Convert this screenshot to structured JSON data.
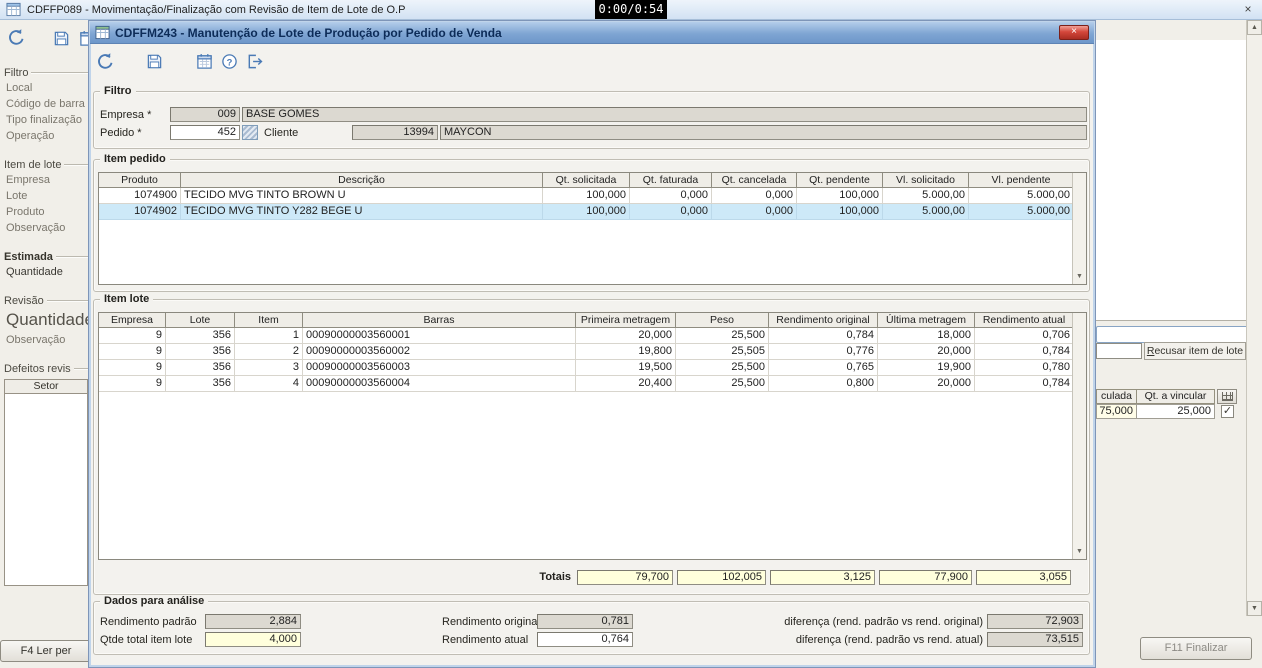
{
  "timer": {
    "text": "0:00/0:54"
  },
  "bg": {
    "title": "CDFFP089 - Movimentação/Finalização com Revisão de Item de Lote de O.P",
    "sidebar": {
      "groups": [
        {
          "legend": "Filtro",
          "items": [
            {
              "t": "Local"
            },
            {
              "t": "Código de barra"
            },
            {
              "t": "Tipo finalização"
            },
            {
              "t": "Operação"
            }
          ]
        },
        {
          "legend": "Item de lote",
          "items": [
            {
              "t": "Empresa"
            },
            {
              "t": "Lote"
            },
            {
              "t": "Produto"
            },
            {
              "t": "Observação"
            }
          ]
        },
        {
          "legend": "Estimada",
          "bold": true,
          "items": [
            {
              "t": "Quantidade",
              "dark": true
            }
          ]
        },
        {
          "legend": "Revisão",
          "items": [
            {
              "t": "Quantidade",
              "big": true
            },
            {
              "t": "Observação"
            }
          ]
        },
        {
          "legend": "Defeitos revis",
          "items": [
            {
              "t": "Setor",
              "header": true
            }
          ]
        }
      ]
    },
    "buttons": {
      "f4": "F4 Ler per",
      "f11": "F11 Finalizar",
      "recusar": "Recusar item de lote"
    },
    "fragment": {
      "col_left": "culada",
      "col_right": "Qt. a vincular",
      "val_left": "75,000",
      "val_right": "25,000",
      "check": "✓"
    }
  },
  "dialog": {
    "title": "CDFFM243 - Manutenção de Lote de Produção por Pedido de Venda",
    "filtro": {
      "legend": "Filtro",
      "empresa_label": "Empresa *",
      "empresa_code": "009",
      "empresa_name": "BASE GOMES",
      "pedido_label": "Pedido *",
      "pedido_value": "452",
      "cliente_label": "Cliente",
      "cliente_code": "13994",
      "cliente_name": "MAYCON"
    },
    "item_pedido": {
      "legend": "Item pedido",
      "columns": [
        "Produto",
        "Descrição",
        "Qt. solicitada",
        "Qt. faturada",
        "Qt. cancelada",
        "Qt. pendente",
        "Vl. solicitado",
        "Vl. pendente"
      ],
      "rows": [
        [
          "1074900",
          "TECIDO MVG TINTO BROWN U",
          "100,000",
          "0,000",
          "0,000",
          "100,000",
          "5.000,00",
          "5.000,00"
        ],
        [
          "1074902",
          "TECIDO MVG TINTO Y282 BEGE U",
          "100,000",
          "0,000",
          "0,000",
          "100,000",
          "5.000,00",
          "5.000,00"
        ]
      ],
      "selected_row": 1
    },
    "item_lote": {
      "legend": "Item lote",
      "columns": [
        "Empresa",
        "Lote",
        "Item",
        "Barras",
        "Primeira metragem",
        "Peso",
        "Rendimento original",
        "Última metragem",
        "Rendimento atual"
      ],
      "rows": [
        [
          "9",
          "356",
          "1",
          "00090000003560001",
          "20,000",
          "25,500",
          "0,784",
          "18,000",
          "0,706"
        ],
        [
          "9",
          "356",
          "2",
          "00090000003560002",
          "19,800",
          "25,505",
          "0,776",
          "20,000",
          "0,784"
        ],
        [
          "9",
          "356",
          "3",
          "00090000003560003",
          "19,500",
          "25,500",
          "0,765",
          "19,900",
          "0,780"
        ],
        [
          "9",
          "356",
          "4",
          "00090000003560004",
          "20,400",
          "25,500",
          "0,800",
          "20,000",
          "0,784"
        ]
      ],
      "totals_label": "Totais",
      "totals": [
        "79,700",
        "102,005",
        "3,125",
        "77,900",
        "3,055"
      ]
    },
    "dados": {
      "legend": "Dados para análise",
      "fields": [
        {
          "label": "Rendimento padrão",
          "value": "2,884"
        },
        {
          "label": "Qtde total item lote",
          "value": "4,000"
        },
        {
          "label": "Rendimento original",
          "value": "0,781"
        },
        {
          "label": "Rendimento atual",
          "value": "0,764"
        },
        {
          "label": "diferença (rend. padrão vs rend. original)",
          "value": "72,903"
        },
        {
          "label": "diferença (rend. padrão vs rend. atual)",
          "value": "73,515"
        }
      ]
    }
  }
}
